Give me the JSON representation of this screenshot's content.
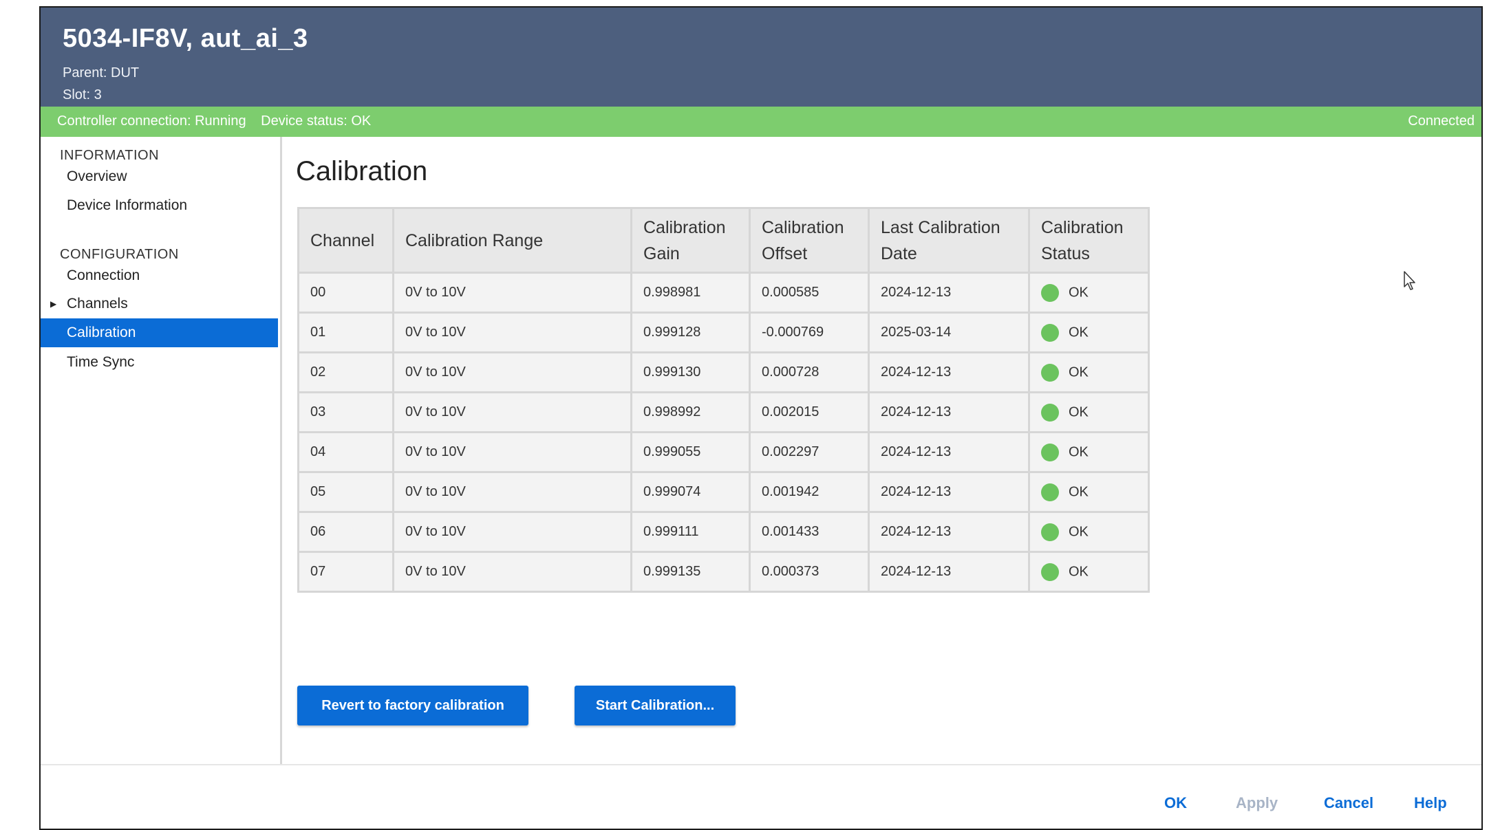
{
  "header": {
    "title": "5034-IF8V, aut_ai_3",
    "parent": "Parent:  DUT",
    "slot": "Slot:  3"
  },
  "status_bar": {
    "controller": "Controller connection: Running",
    "device": "Device status: OK",
    "connection": "Connected",
    "color": "#7dcd6e"
  },
  "sidebar": {
    "sections": [
      {
        "title": "INFORMATION",
        "items": [
          "Overview",
          "Device Information"
        ]
      },
      {
        "title": "CONFIGURATION",
        "items": [
          "Connection",
          "Channels",
          "Calibration",
          "Time Sync"
        ]
      }
    ],
    "selected": "Calibration",
    "accent": "#0b6cd6"
  },
  "main": {
    "title": "Calibration",
    "table": {
      "headers": [
        "Channel",
        "Calibration Range",
        "Calibration Gain",
        "Calibration Offset",
        "Last Calibration Date",
        "Calibration Status"
      ],
      "rows": [
        [
          "00",
          "0V to 10V",
          "0.998981",
          "0.000585",
          "2024-12-13",
          "OK"
        ],
        [
          "01",
          "0V to 10V",
          "0.999128",
          "-0.000769",
          "2025-03-14",
          "OK"
        ],
        [
          "02",
          "0V to 10V",
          "0.999130",
          "0.000728",
          "2024-12-13",
          "OK"
        ],
        [
          "03",
          "0V to 10V",
          "0.998992",
          "0.002015",
          "2024-12-13",
          "OK"
        ],
        [
          "04",
          "0V to 10V",
          "0.999055",
          "0.002297",
          "2024-12-13",
          "OK"
        ],
        [
          "05",
          "0V to 10V",
          "0.999074",
          "0.001942",
          "2024-12-13",
          "OK"
        ],
        [
          "06",
          "0V to 10V",
          "0.999111",
          "0.001433",
          "2024-12-13",
          "OK"
        ],
        [
          "07",
          "0V to 10V",
          "0.999135",
          "0.000373",
          "2024-12-13",
          "OK"
        ]
      ],
      "status_color": "#6bc35e"
    },
    "buttons": {
      "revert": "Revert to factory calibration",
      "start": "Start Calibration..."
    }
  },
  "footer": {
    "ok": "OK",
    "apply": "Apply",
    "cancel": "Cancel",
    "help": "Help"
  }
}
